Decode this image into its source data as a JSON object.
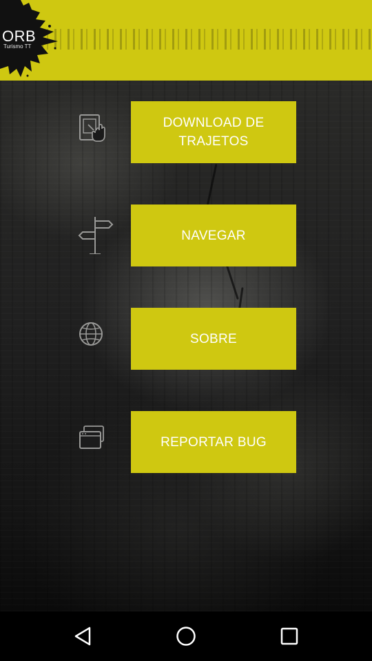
{
  "header": {
    "logo_title": "ORB",
    "logo_subtitle": "Turismo TT",
    "background_color": "#cfc811"
  },
  "menu": {
    "items": [
      {
        "label": "DOWNLOAD DE TRAJETOS",
        "icon": "tablet-touch-icon"
      },
      {
        "label": "NAVEGAR",
        "icon": "signpost-icon"
      },
      {
        "label": "SOBRE",
        "icon": "globe-icon"
      },
      {
        "label": "REPORTAR BUG",
        "icon": "windows-stack-icon"
      }
    ],
    "button_color": "#cfc811",
    "text_color": "#ffffff"
  },
  "navbar": {
    "back": "back-triangle-icon",
    "home": "home-circle-icon",
    "recents": "recents-square-icon"
  }
}
